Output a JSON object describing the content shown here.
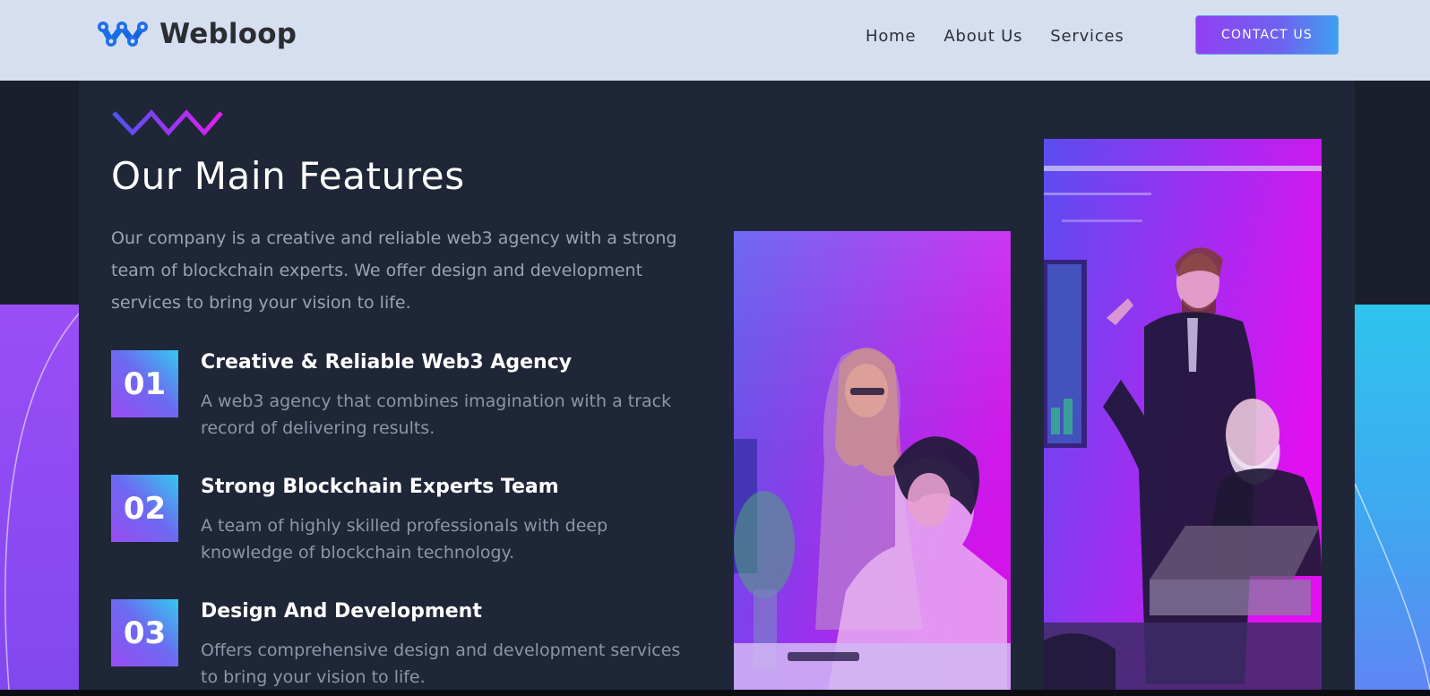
{
  "brand": {
    "name": "Webloop",
    "logo_icon": "network-nodes-logo-icon",
    "accent_gradient": [
      "#9140f3",
      "#3f9ff0"
    ]
  },
  "nav": {
    "items": [
      {
        "label": "Home"
      },
      {
        "label": "About Us"
      },
      {
        "label": "Services"
      }
    ],
    "cta_label": "CONTACT US"
  },
  "features_section": {
    "decor_icon": "zigzag-icon",
    "title": "Our Main Features",
    "intro": "Our company is a creative and reliable web3 agency with a strong team of blockchain experts. We offer design and development services to bring your vision to life.",
    "items": [
      {
        "number": "01",
        "title": "Creative & Reliable Web3 Agency",
        "description": "A web3 agency that combines imagination with a track record of delivering results."
      },
      {
        "number": "02",
        "title": "Strong Blockchain Experts Team",
        "description": "A team of highly skilled professionals with deep knowledge of blockchain technology."
      },
      {
        "number": "03",
        "title": "Design And Development",
        "description": "Offers comprehensive design and development services to bring your vision to life."
      }
    ],
    "images": [
      {
        "subject": "two-women-at-laptop-photo"
      },
      {
        "subject": "man-presenting-to-colleagues-photo"
      }
    ]
  },
  "colors": {
    "header_bg": "#d6dff0",
    "section_bg": "#1f2637",
    "page_bg": "#1a1f2b",
    "text_muted": "#9aa3b5",
    "badge_gradient": [
      "#35c9ef",
      "#9a4cf4"
    ],
    "photo_overlay": [
      "#5a4ef0",
      "#e010f0"
    ]
  }
}
